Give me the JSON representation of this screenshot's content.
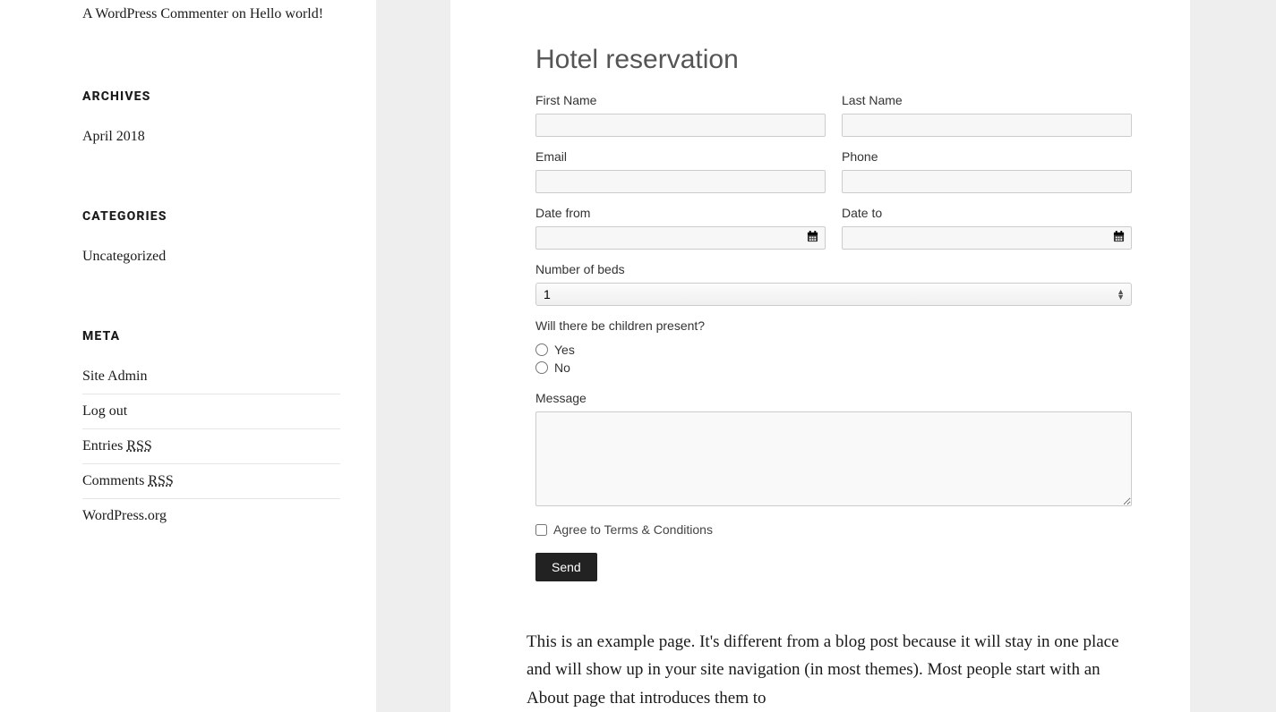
{
  "sidebar": {
    "recent_comment": {
      "author": "A WordPress Commenter",
      "joiner": " on ",
      "post": "Hello world!"
    },
    "archives": {
      "title": "ARCHIVES",
      "items": [
        "April 2018"
      ]
    },
    "categories": {
      "title": "CATEGORIES",
      "items": [
        "Uncategorized"
      ]
    },
    "meta": {
      "title": "META",
      "items": [
        {
          "label": "Site Admin"
        },
        {
          "label": "Log out"
        },
        {
          "label_prefix": "Entries ",
          "abbr": "RSS"
        },
        {
          "label_prefix": "Comments ",
          "abbr": "RSS"
        },
        {
          "label": "WordPress.org"
        }
      ]
    }
  },
  "form": {
    "title": "Hotel reservation",
    "first_name_label": "First Name",
    "last_name_label": "Last Name",
    "email_label": "Email",
    "phone_label": "Phone",
    "date_from_label": "Date from",
    "date_to_label": "Date to",
    "beds_label": "Number of beds",
    "beds_value": "1",
    "children_label": "Will there be children present?",
    "children_yes": "Yes",
    "children_no": "No",
    "message_label": "Message",
    "terms_label": "Agree to Terms & Conditions",
    "send_label": "Send"
  },
  "body_text": "This is an example page. It's different from a blog post because it will stay in one place and will show up in your site navigation (in most themes). Most people start with an About page that introduces them to"
}
